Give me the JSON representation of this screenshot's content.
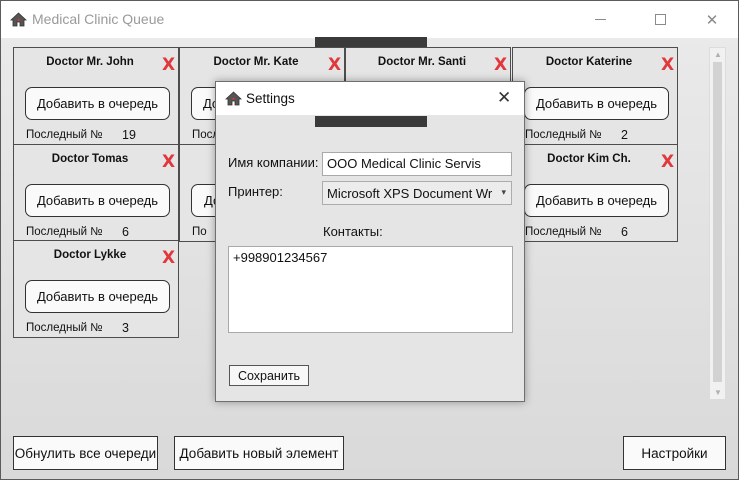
{
  "window": {
    "title": "Medical Clinic Queue",
    "controls": {
      "minimize": "minimize",
      "maximize": "maximize",
      "close": "✕"
    }
  },
  "cards": [
    {
      "name": "Doctor Mr. John",
      "add_label": "Добавить в очередь",
      "last_label": "Последный №",
      "last_value": "19"
    },
    {
      "name": "Doctor Mr. Kate",
      "add_label": "Добавить в очередь",
      "last_label": "Последный №",
      "last_value": ""
    },
    {
      "name": "Doctor Mr. Santi",
      "add_label": "",
      "last_label": "",
      "last_value": ""
    },
    {
      "name": "Doctor Katerine",
      "add_label": "Добавить в очередь",
      "last_label": "Последный №",
      "last_value": "2"
    },
    {
      "name": "Doctor Tomas",
      "add_label": "Добавить в очередь",
      "last_label": "Последный №",
      "last_value": "6"
    },
    {
      "name": "",
      "add_label": "До",
      "last_label": "По",
      "last_value": ""
    },
    {
      "name": "",
      "add_label": "",
      "last_label": "",
      "last_value": ""
    },
    {
      "name": "Doctor Kim Ch.",
      "add_label": "Добавить в очередь",
      "last_label": "Последный №",
      "last_value": "6"
    },
    {
      "name": "Doctor Lykke",
      "add_label": "Добавить в очередь",
      "last_label": "Последный №",
      "last_value": "3"
    }
  ],
  "remove_glyph": "X",
  "bottom_bar": {
    "reset_label": "Обнулить все очереди",
    "add_new_label": "Добавить новый элемент",
    "settings_label": "Настройки"
  },
  "settings_dialog": {
    "title": "Settings",
    "close_glyph": "✕",
    "company_label": "Имя компании:",
    "company_value": "OOO Medical Clinic Servis",
    "printer_label": "Принтер:",
    "printer_value": "Microsoft XPS Document Wr",
    "contacts_label": "Контакты:",
    "contacts_value": "+998901234567",
    "save_label": "Сохранить"
  },
  "colors": {
    "remove": "#e0383c",
    "accent_dark": "#3a3a3a"
  },
  "icons": {
    "app": "house-icon",
    "scroll_up": "chevron-up-icon",
    "scroll_down": "chevron-down-icon",
    "dropdown": "chevron-down-icon"
  }
}
